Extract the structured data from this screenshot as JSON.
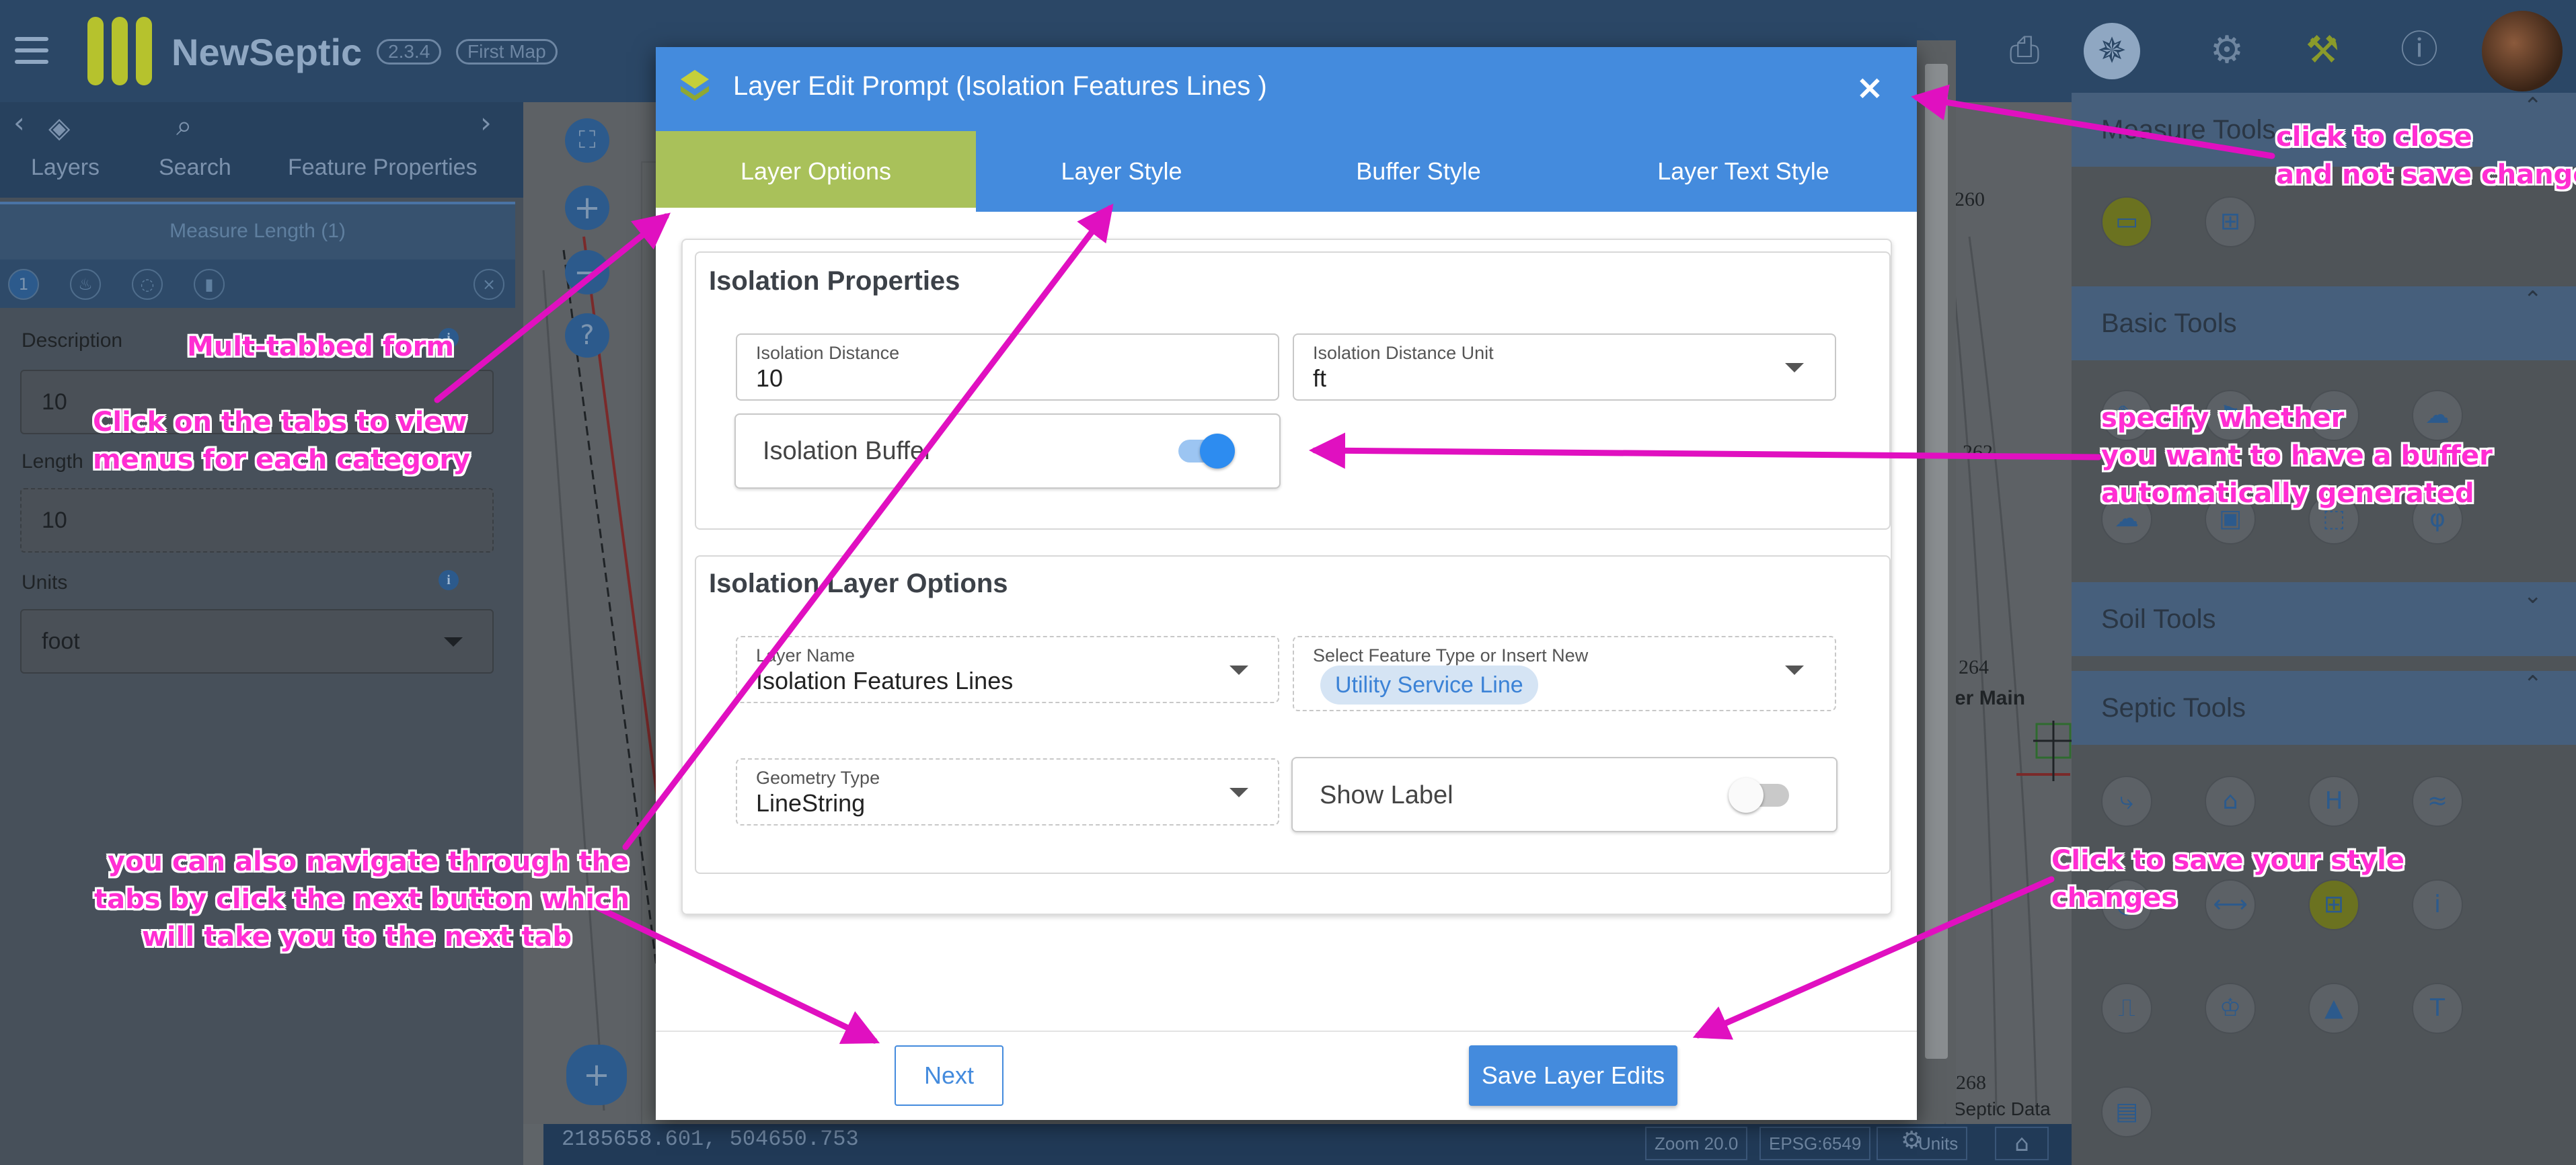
{
  "app": {
    "name": "NewSeptic",
    "version": "2.3.4",
    "map_name": "First Map"
  },
  "left_panel": {
    "tabs": [
      {
        "label": "Layers"
      },
      {
        "label": "Search"
      },
      {
        "label": "Feature Properties"
      }
    ],
    "measure_header": "Measure Length (1)",
    "measure_index": "1",
    "fields": {
      "description_label": "Description",
      "description_value": "10",
      "length_label": "Length",
      "length_value": "10",
      "units_label": "Units",
      "units_value": "foot"
    }
  },
  "map": {
    "coords": "2185658.601, 504650.753",
    "zoom": "Zoom 20.0",
    "epsg": "EPSG:6549",
    "units": "Units",
    "contour_labels": [
      "260",
      "262",
      "264",
      "268"
    ],
    "feature_label": "er Main",
    "septic_data": "Septic Data"
  },
  "right_panel": {
    "sections": [
      {
        "title": "Measure Tools",
        "chevron": "up"
      },
      {
        "title": "Basic Tools",
        "chevron": "up"
      },
      {
        "title": "Soil Tools",
        "chevron": "down"
      },
      {
        "title": "Septic Tools",
        "chevron": "up"
      }
    ]
  },
  "dialog": {
    "title": "Layer Edit Prompt (Isolation Features Lines )",
    "close": "×",
    "tabs": [
      {
        "label": "Layer Options",
        "active": true
      },
      {
        "label": "Layer Style",
        "active": false
      },
      {
        "label": "Buffer Style",
        "active": false
      },
      {
        "label": "Layer Text Style",
        "active": false
      }
    ],
    "isolation_properties": {
      "title": "Isolation Properties",
      "distance_label": "Isolation Distance",
      "distance_value": "10",
      "unit_label": "Isolation Distance Unit",
      "unit_value": "ft",
      "buffer_label": "Isolation Buffer",
      "buffer_on": true
    },
    "layer_options": {
      "title": "Isolation Layer Options",
      "layer_name_label": "Layer Name",
      "layer_name_value": "Isolation Features Lines",
      "feature_type_label": "Select Feature Type or Insert New",
      "feature_type_value": "Utility Service Line",
      "geometry_label": "Geometry Type",
      "geometry_value": "LineString",
      "show_label": "Show Label",
      "show_label_on": false
    },
    "next_label": "Next",
    "save_label": "Save Layer Edits"
  },
  "annotations": {
    "multi_tab": "Mult-tabbed form",
    "click_tabs_1": "Click on the tabs to view",
    "click_tabs_2": "menus for each category",
    "close_1": "click to close",
    "close_2": "and not save changes",
    "buffer_1": "specify whether",
    "buffer_2": "you want to have a buffer",
    "buffer_3": "automatically generated",
    "nav_1": "you can also navigate through the",
    "nav_2": "tabs by click the next button which",
    "nav_3": "will take you to the next tab",
    "save_1": "Click to save your style",
    "save_2": "changes"
  },
  "colors": {
    "accent": "#448bdd",
    "active_tab": "#a9c15a",
    "annotation": "#ff2dd2",
    "topbar": "#2b4766"
  },
  "icons": {
    "menu": "hamburger-icon",
    "print": "printer-icon",
    "compass": "compass-icon",
    "settings": "gear-icon",
    "tools": "tools-icon",
    "info": "info-icon",
    "layers": "layers-icon",
    "search": "search-icon",
    "close": "close-icon"
  }
}
